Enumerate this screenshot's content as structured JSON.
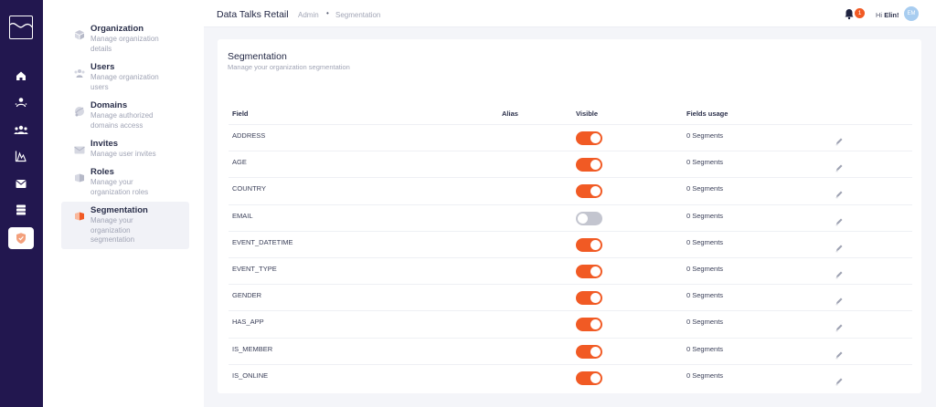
{
  "colors": {
    "accent": "#f15a24",
    "rail": "#22174f",
    "toggle_off": "#c3c5cf"
  },
  "rail": {
    "icons": [
      "home-icon",
      "user-profile-icon",
      "users-icon",
      "analytics-icon",
      "mailbox-icon",
      "database-icon",
      "shield-icon"
    ],
    "active": "shield-icon"
  },
  "subnav": {
    "items": [
      {
        "title": "Organization",
        "desc": "Manage organization details",
        "icon": "organization-icon"
      },
      {
        "title": "Users",
        "desc": "Manage organization users",
        "icon": "users-icon"
      },
      {
        "title": "Domains",
        "desc": "Manage authorized domains access",
        "icon": "domain-icon"
      },
      {
        "title": "Invites",
        "desc": "Manage user invites",
        "icon": "envelope-icon"
      },
      {
        "title": "Roles",
        "desc": "Manage your organization roles",
        "icon": "roles-icon"
      },
      {
        "title": "Segmentation",
        "desc": "Manage your organization segmentation",
        "icon": "segmentation-icon"
      }
    ],
    "active": "Segmentation"
  },
  "topbar": {
    "title": "Data Talks Retail",
    "breadcrumb": [
      "Admin",
      "Segmentation"
    ],
    "breadcrumb_separator": "•",
    "notification_count": "1",
    "greeting": "Hi",
    "user_name": "Elin!",
    "avatar_initials": "EM"
  },
  "card": {
    "title": "Segmentation",
    "subtitle": "Manage your organization segmentation",
    "columns": {
      "field": "Field",
      "alias": "Alias",
      "visible": "Visible",
      "usage": "Fields usage"
    },
    "rows": [
      {
        "field": "ADDRESS",
        "alias": "",
        "visible": true,
        "usage": "0 Segments"
      },
      {
        "field": "AGE",
        "alias": "",
        "visible": true,
        "usage": "0 Segments"
      },
      {
        "field": "COUNTRY",
        "alias": "",
        "visible": true,
        "usage": "0 Segments"
      },
      {
        "field": "EMAIL",
        "alias": "",
        "visible": false,
        "usage": "0 Segments"
      },
      {
        "field": "EVENT_DATETIME",
        "alias": "",
        "visible": true,
        "usage": "0 Segments"
      },
      {
        "field": "EVENT_TYPE",
        "alias": "",
        "visible": true,
        "usage": "0 Segments"
      },
      {
        "field": "GENDER",
        "alias": "",
        "visible": true,
        "usage": "0 Segments"
      },
      {
        "field": "HAS_APP",
        "alias": "",
        "visible": true,
        "usage": "0 Segments"
      },
      {
        "field": "IS_MEMBER",
        "alias": "",
        "visible": true,
        "usage": "0 Segments"
      },
      {
        "field": "IS_ONLINE",
        "alias": "",
        "visible": true,
        "usage": "0 Segments"
      }
    ]
  }
}
